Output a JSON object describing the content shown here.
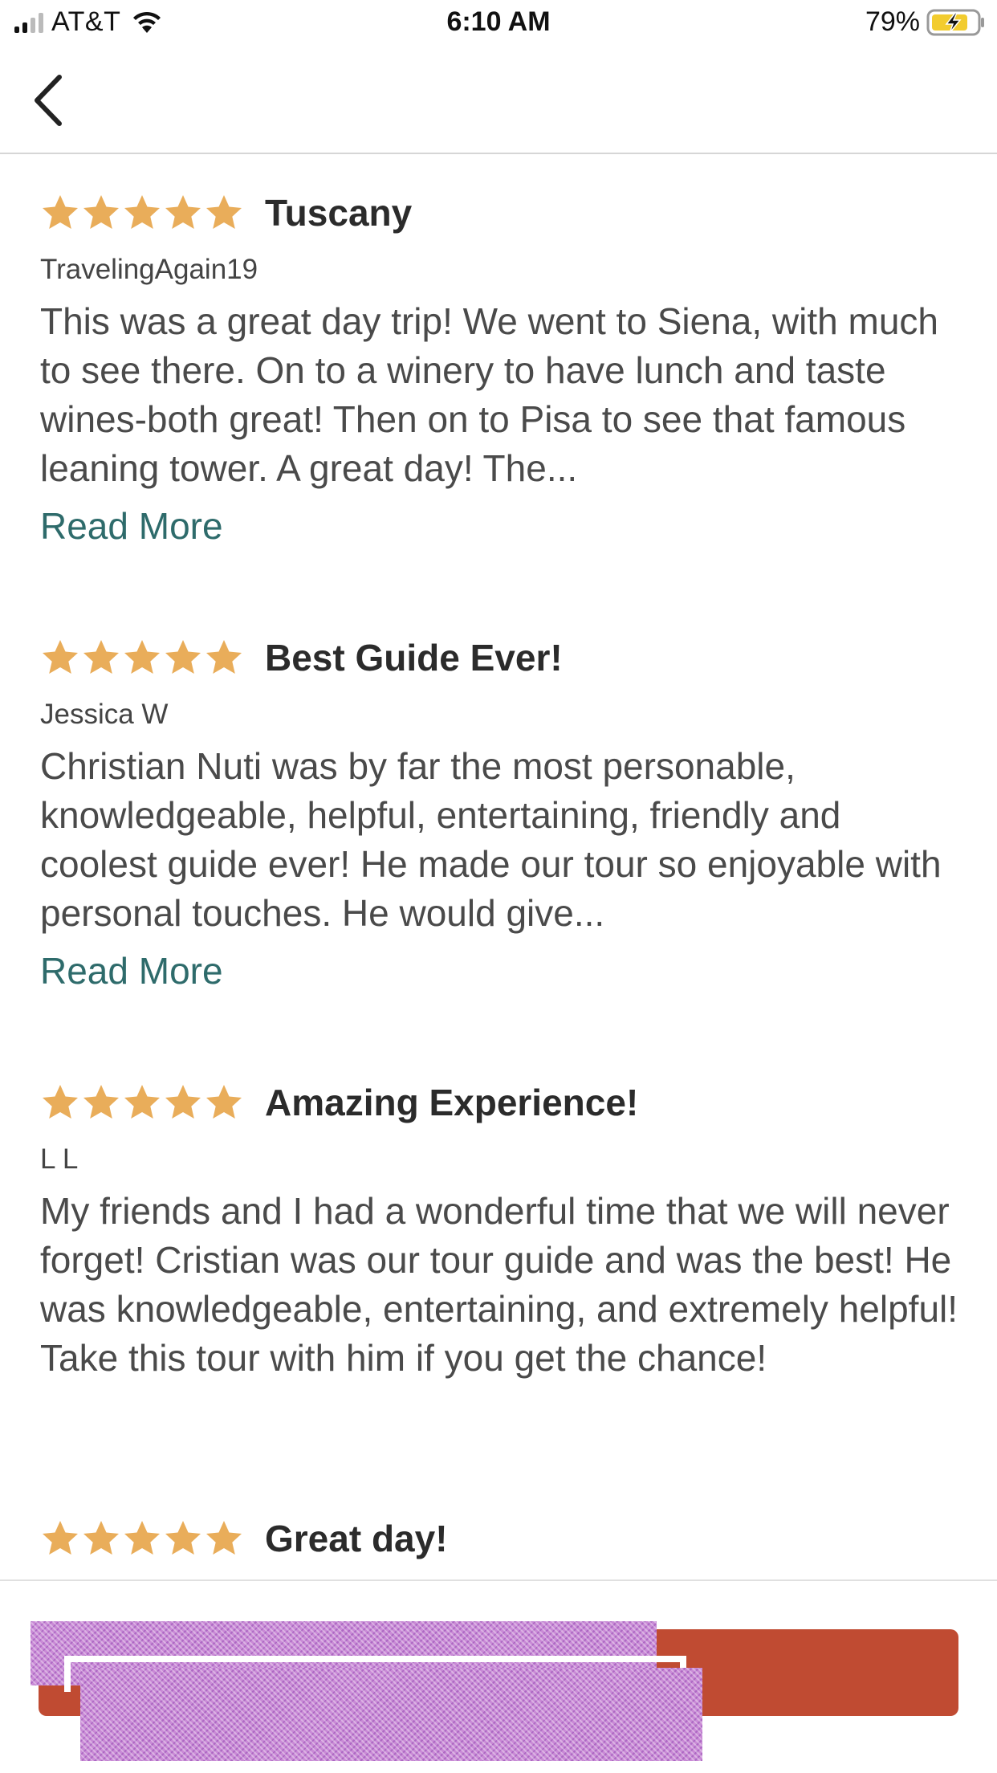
{
  "status_bar": {
    "carrier": "AT&T",
    "time": "6:10 AM",
    "battery_percent": "79%",
    "signal_icon": "cellular-signal-icon",
    "wifi_icon": "wifi-icon",
    "battery_icon": "battery-charging-icon"
  },
  "nav": {
    "back_icon": "chevron-left-icon"
  },
  "colors": {
    "star": "#e9ad5a",
    "read_more": "#2e6b6b",
    "cta": "#c04b32",
    "redaction": "#c98ad6"
  },
  "reviews": [
    {
      "rating": 5,
      "title": "Tuscany",
      "author": "TravelingAgain19",
      "body": "This was a great day trip! We went to Siena, with much to see there. On to a winery to have lunch and taste wines-both great! Then on to Pisa to see that famous leaning tower. A great day! The...",
      "read_more": "Read More"
    },
    {
      "rating": 5,
      "title": "Best Guide Ever!",
      "author": "Jessica W",
      "body": "Christian Nuti was by far the most personable, knowledgeable, helpful, entertaining, friendly and coolest guide ever! He made our tour so enjoyable with personal touches. He would give...",
      "read_more": "Read More"
    },
    {
      "rating": 5,
      "title": "Amazing Experience!",
      "author": "L L",
      "body": "My friends and I had a wonderful time that we will never forget! Cristian was our tour guide and was the best! He was knowledgeable, entertaining, and extremely helpful! Take this tour with him if you get the chance!"
    },
    {
      "rating": 5,
      "title": "Great day!"
    }
  ]
}
